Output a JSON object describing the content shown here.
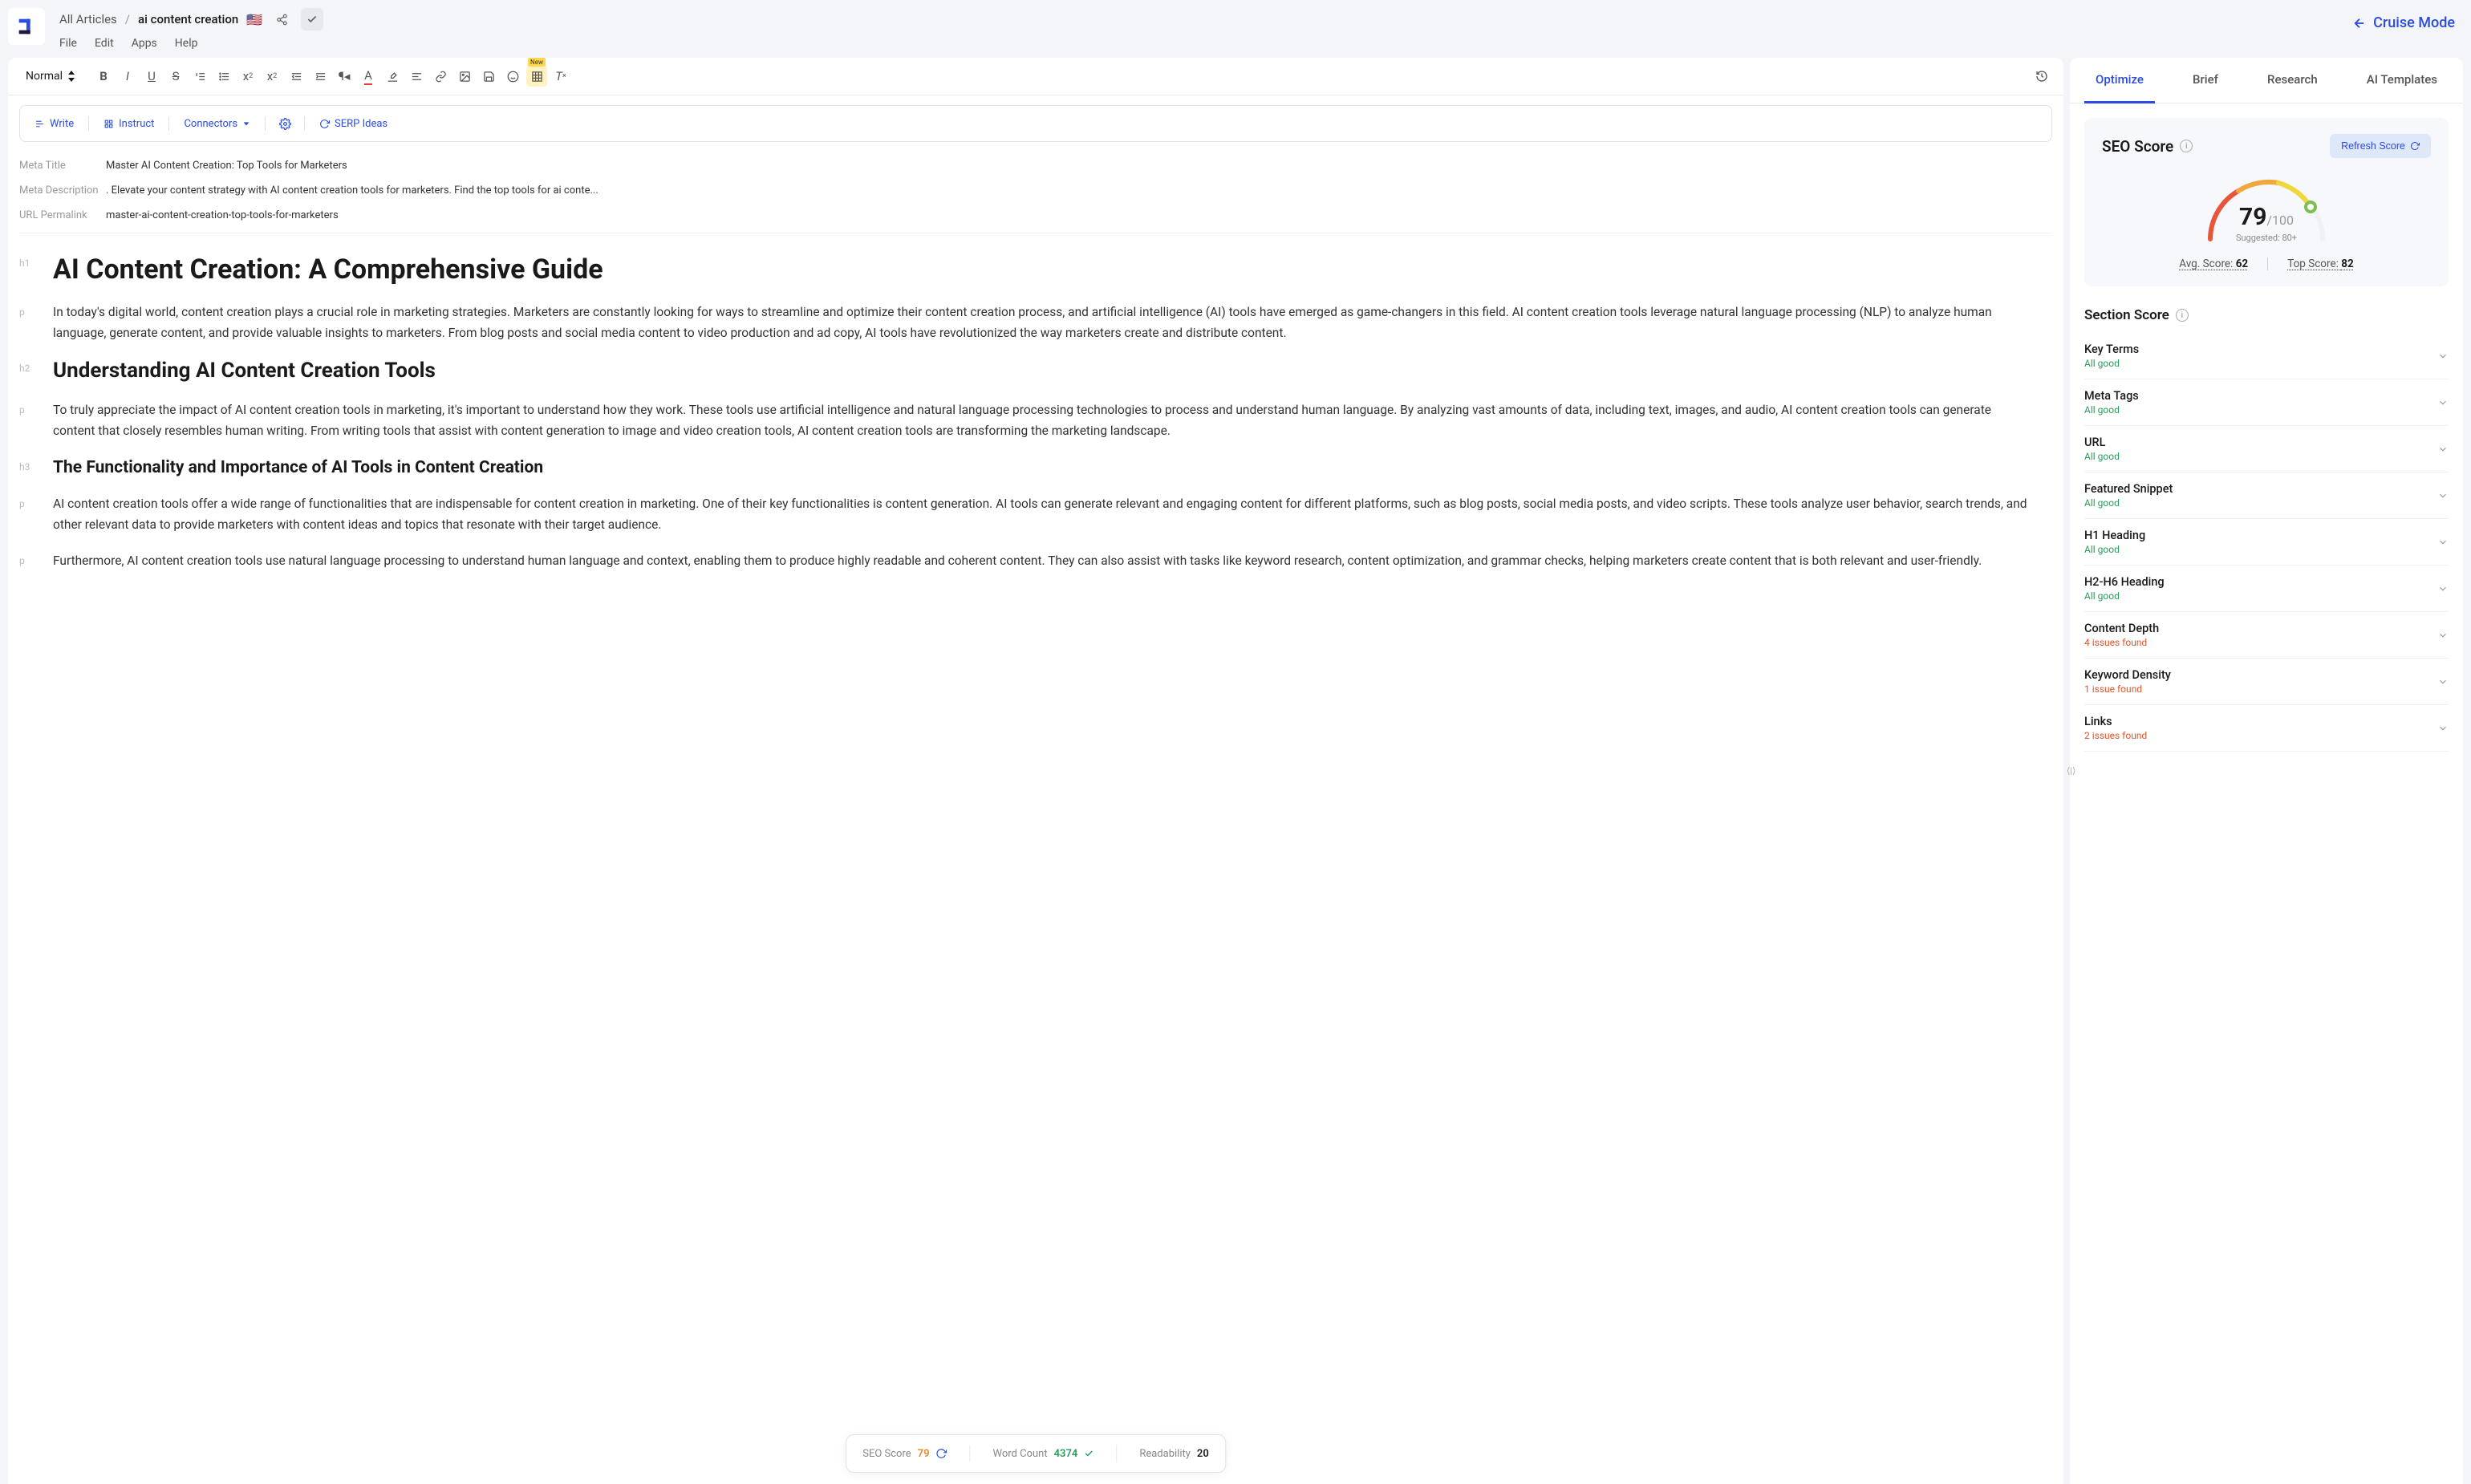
{
  "breadcrumb": {
    "parent": "All Articles",
    "current": "ai content creation"
  },
  "menus": {
    "file": "File",
    "edit": "Edit",
    "apps": "Apps",
    "help": "Help"
  },
  "cruise_mode": "Cruise Mode",
  "format_select": "Normal",
  "new_badge": "New",
  "action_bar": {
    "write": "Write",
    "instruct": "Instruct",
    "connectors": "Connectors",
    "serp": "SERP Ideas"
  },
  "meta": {
    "title_label": "Meta Title",
    "title_value": "Master AI Content Creation: Top Tools for Marketers",
    "desc_label": "Meta Description",
    "desc_value": ". Elevate your content strategy with AI content creation tools for marketers. Find the top tools for ai conte...",
    "url_label": "URL Permalink",
    "url_value": "master-ai-content-creation-top-tools-for-marketers"
  },
  "doc": {
    "b1_tag": "h1",
    "b1": "AI Content Creation: A Comprehensive Guide",
    "b2_tag": "p",
    "b2": "In today's digital world, content creation plays a crucial role in marketing strategies. Marketers are constantly looking for ways to streamline and optimize their content creation process, and artificial intelligence (AI) tools have emerged as game-changers in this field. AI content creation tools leverage natural language processing (NLP) to analyze human language, generate content, and provide valuable insights to marketers. From blog posts and social media content to video production and ad copy, AI tools have revolutionized the way marketers create and distribute content.",
    "b3_tag": "h2",
    "b3": "Understanding AI Content Creation Tools",
    "b4_tag": "p",
    "b4": "To truly appreciate the impact of AI content creation tools in marketing, it's important to understand how they work. These tools use artificial intelligence and natural language processing technologies to process and understand human language. By analyzing vast amounts of data, including text, images, and audio, AI content creation tools can generate content that closely resembles human writing. From writing tools that assist with content generation to image and video creation tools, AI content creation tools are transforming the marketing landscape.",
    "b5_tag": "h3",
    "b5": "The Functionality and Importance of AI Tools in Content Creation",
    "b6_tag": "p",
    "b6": "AI content creation tools offer a wide range of functionalities that are indispensable for content creation in marketing. One of their key functionalities is content generation. AI tools can generate relevant and engaging content for different platforms, such as blog posts, social media posts, and video scripts. These tools analyze user behavior, search trends, and other relevant data to provide marketers with content ideas and topics that resonate with their target audience.",
    "b7_tag": "p",
    "b7": " Furthermore, AI content creation tools use natural language processing to understand human language and context, enabling them to produce highly readable and coherent content. They can also assist with tasks like keyword research, content optimization, and grammar checks, helping marketers create content that is both relevant and user-friendly."
  },
  "status": {
    "seo_label": "SEO Score",
    "seo_val": "79",
    "wc_label": "Word Count",
    "wc_val": "4374",
    "read_label": "Readability",
    "read_val": "20"
  },
  "side": {
    "tabs": {
      "optimize": "Optimize",
      "brief": "Brief",
      "research": "Research",
      "ai": "AI Templates"
    },
    "seo_title": "SEO Score",
    "refresh": "Refresh Score",
    "score": "79",
    "score_max": "/100",
    "suggested": "Suggested: 80+",
    "avg_label": "Avg. Score: ",
    "avg_val": "62",
    "top_label": "Top Score: ",
    "top_val": "82",
    "section_title": "Section Score",
    "sections": [
      {
        "name": "Key Terms",
        "status": "All good",
        "ok": true
      },
      {
        "name": "Meta Tags",
        "status": "All good",
        "ok": true
      },
      {
        "name": "URL",
        "status": "All good",
        "ok": true
      },
      {
        "name": "Featured Snippet",
        "status": "All good",
        "ok": true
      },
      {
        "name": "H1 Heading",
        "status": "All good",
        "ok": true
      },
      {
        "name": "H2-H6 Heading",
        "status": "All good",
        "ok": true
      },
      {
        "name": "Content Depth",
        "status": "4 issues found",
        "ok": false
      },
      {
        "name": "Keyword Density",
        "status": "1 issue found",
        "ok": false
      },
      {
        "name": "Links",
        "status": "2 issues found",
        "ok": false
      }
    ]
  }
}
